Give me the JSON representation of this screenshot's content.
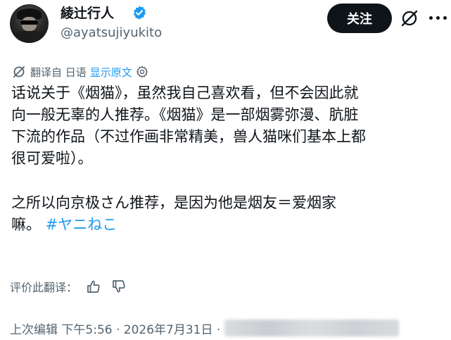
{
  "header": {
    "display_name": "綾辻行人",
    "handle": "@ayatsujiyukito",
    "follow_label": "关注"
  },
  "translation": {
    "prefix": "翻译自 日语",
    "show_original": "显示原文"
  },
  "tweet": {
    "lines": [
      "话说关于《烟猫》，虽然我自己喜欢看，但不会因此就",
      "向一般无辜的人推荐。《烟猫》是一部烟雾弥漫、肮脏",
      "下流的作品（不过作画非常精美，兽人猫咪们基本上都",
      "很可爱啦）。"
    ],
    "lines2": [
      "之所以向京极さん推荐，是因为他是烟友＝爱烟家",
      "嘛。"
    ],
    "hashtag": "#ヤニねこ"
  },
  "rate": {
    "label": "评价此翻译："
  },
  "meta": {
    "time": "上次编辑 下午5:56 · 2026年7月31日 ·"
  },
  "icons": {
    "verified": "verified-badge-icon",
    "mute": "mute-icon",
    "translate": "translate-icon",
    "settings": "gear-icon",
    "thumbs_up": "thumbs-up-icon",
    "thumbs_down": "thumbs-down-icon"
  },
  "colors": {
    "accent": "#1d9bf0",
    "text": "#0f1419",
    "secondary": "#536471",
    "follow_bg": "#0f1419"
  }
}
